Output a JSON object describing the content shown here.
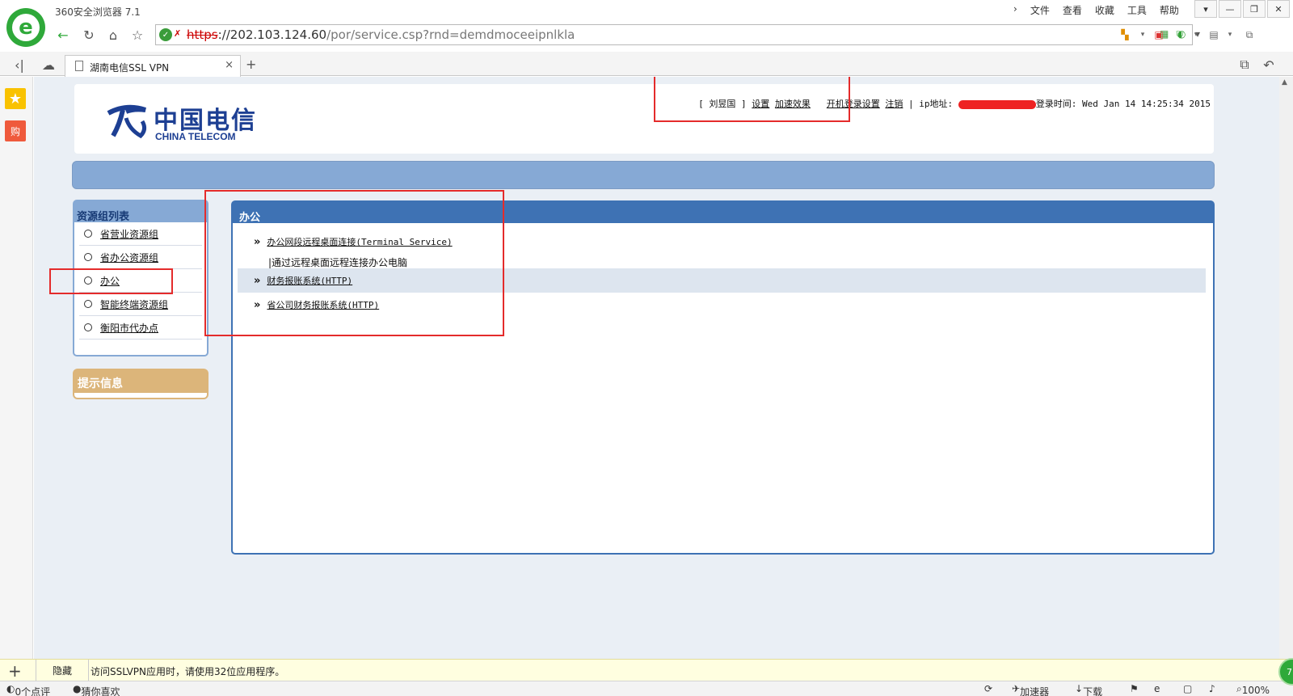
{
  "browser": {
    "title": "360安全浏览器 7.1",
    "menu": [
      "文件",
      "查看",
      "收藏",
      "工具",
      "帮助"
    ],
    "url_protocol": "https",
    "url_host": "://202.103.124.60",
    "url_path": "/por/service.csp?rnd=demdmoceeipnlkla",
    "tab_title": "湖南电信SSL VPN",
    "status_bar": {
      "comments": "0个点评",
      "guess": "猜你喜欢",
      "accelerator": "加速器",
      "download": "下载",
      "zoom": "100%"
    },
    "notify": {
      "hide_label": "隐藏",
      "message": "访问SSLVPN应用时，请使用32位应用程序。"
    }
  },
  "header": {
    "logo_cn": "中国电信",
    "logo_en": "CHINA TELECOM",
    "user_open": "[ ",
    "user_name": "刘昱国",
    "user_close": " ]",
    "settings": "设置",
    "speedup": "加速效果",
    "boot_login": "开机登录设置",
    "logout": "注销",
    "ip_label": "ip地址:",
    "login_time_label": "登录时间:",
    "login_time": "Wed Jan 14 14:25:34 2015"
  },
  "left_panel": {
    "title": "资源组列表",
    "items": [
      "省营业资源组",
      "省办公资源组",
      "办公",
      "智能终端资源组",
      "衡阳市代办点"
    ]
  },
  "tip_panel": {
    "title": "提示信息"
  },
  "main_panel": {
    "title": "办公",
    "rows": [
      {
        "label": "办公网段远程桌面连接(Terminal Service)",
        "desc": "通过远程桌面远程连接办公电脑"
      },
      {
        "label": "财务报账系统(HTTP)"
      },
      {
        "label": "省公司财务报账系统(HTTP)"
      }
    ]
  },
  "colors": {
    "blue_bar": "#86a9d5",
    "main_panel_header": "#3e72b4",
    "tip_header": "#dcb57a",
    "annotation_red": "#e42b2b",
    "brand_blue": "#1d3f93"
  }
}
